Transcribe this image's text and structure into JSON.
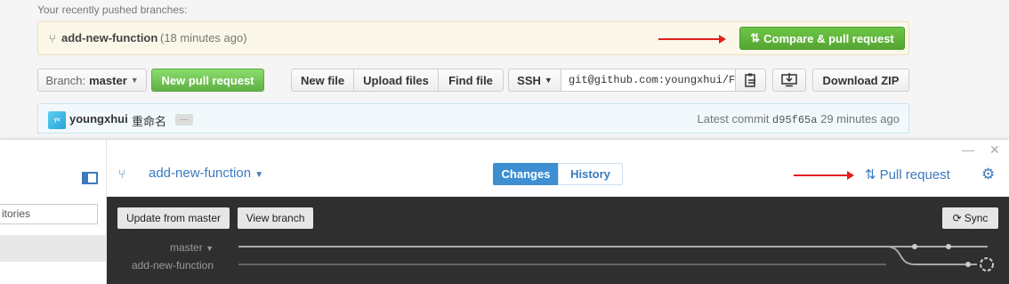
{
  "github": {
    "pushed_label": "Your recently pushed branches:",
    "pushed_branch": "add-new-function",
    "pushed_time": "(18 minutes ago)",
    "compare_button": "Compare & pull request",
    "branch_prefix": "Branch:",
    "branch_value": "master",
    "new_pr_button": "New pull request",
    "file_buttons": [
      "New file",
      "Upload files",
      "Find file"
    ],
    "clone_protocol": "SSH",
    "clone_url": "git@github.com:youngxhui/Fi",
    "download_zip": "Download ZIP",
    "commit": {
      "author": "youngxhui",
      "message": "重命名",
      "ellipsis": "…",
      "latest_label": "Latest commit",
      "sha": "d95f65a",
      "time": "29 minutes ago"
    }
  },
  "desktop": {
    "window_controls": [
      "—",
      "☐",
      "✕"
    ],
    "repo_filter_placeholder": "itories",
    "current_branch": "add-new-function",
    "tabs": {
      "changes": "Changes",
      "history": "History"
    },
    "pull_request_link": "Pull request",
    "update_button": "Update from master",
    "view_branch_button": "View branch",
    "sync_button": "Sync",
    "lanes": {
      "master": "master",
      "feature": "add-new-function"
    }
  },
  "colors": {
    "accent_green": "#60b044",
    "desktop_blue": "#3a7bbf",
    "annotation_red": "#e02020",
    "graph_dark": "#2f2f2f"
  }
}
